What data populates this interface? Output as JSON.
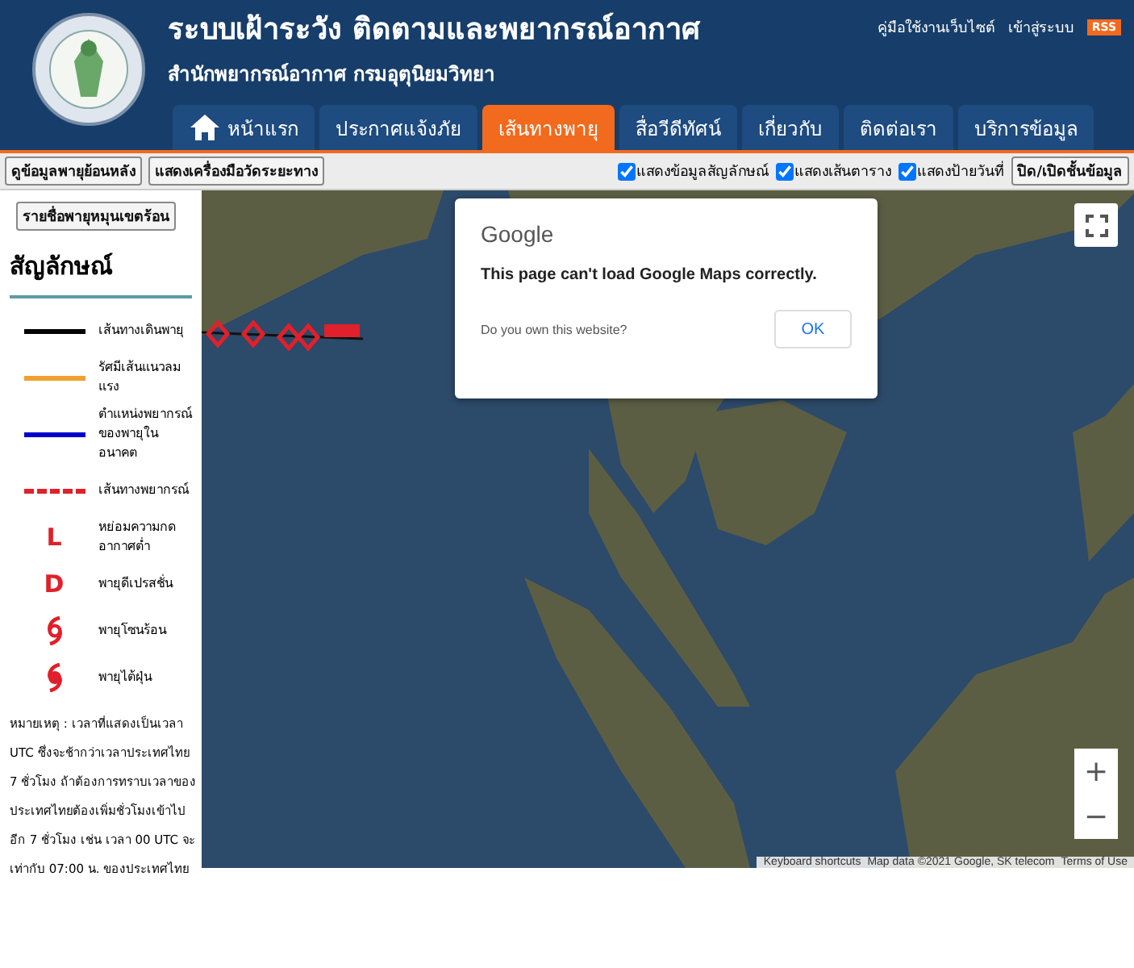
{
  "header": {
    "title": "ระบบเฝ้าระวัง ติดตามและพยากรณ์อากาศ",
    "subtitle": "สำนักพยากรณ์อากาศ กรมอุตุนิยมวิทยา",
    "links": [
      "คู่มือใช้งานเว็บไซต์",
      "เข้าสู่ระบบ"
    ],
    "rss": "RSS"
  },
  "nav": [
    {
      "label": "หน้าแรก",
      "home": true,
      "selected": false
    },
    {
      "label": "ประกาศแจ้งภัย",
      "home": false,
      "selected": false
    },
    {
      "label": "เส้นทางพายุ",
      "home": false,
      "selected": true
    },
    {
      "label": "สื่อวีดีทัศน์",
      "home": false,
      "selected": false
    },
    {
      "label": "เกี่ยวกับ",
      "home": false,
      "selected": false
    },
    {
      "label": "ติดต่อเรา",
      "home": false,
      "selected": false
    },
    {
      "label": "บริการข้อมูล",
      "home": false,
      "selected": false
    }
  ],
  "toolbar": {
    "buttons": [
      "ดูข้อมูลพายุย้อนหลัง",
      "แสดงเครื่องมือวัดระยะทาง"
    ],
    "checkboxes": [
      {
        "label": "แสดงข้อมูลสัญลักษณ์",
        "checked": true
      },
      {
        "label": "แสดงเส้นตาราง",
        "checked": true
      },
      {
        "label": "แสดงป้ายวันที่",
        "checked": true
      }
    ],
    "toggle": "ปิด/เปิดชั้นข้อมูล"
  },
  "sidebar": {
    "button": "รายชื่อพายุหมุนเขตร้อน",
    "heading": "สัญลักษณ์",
    "legend": [
      {
        "kind": "line",
        "color": "#000000",
        "label": "เส้นทางเดินพายุ"
      },
      {
        "kind": "line",
        "color": "#f0a030",
        "label": "รัศมีเส้นแนวลมแรง"
      },
      {
        "kind": "line",
        "color": "#0000cc",
        "label": "ตำแหน่งพยากรณ์ของพายุในอนาคต"
      },
      {
        "kind": "dashed",
        "color": "#e0202a",
        "label": "เส้นทางพยากรณ์"
      },
      {
        "kind": "letter",
        "symbol": "L",
        "label": "หย่อมความกดอากาศต่ำ"
      },
      {
        "kind": "letter",
        "symbol": "D",
        "label": "พายุดีเปรสชั่น"
      },
      {
        "kind": "storm",
        "label": "พายุโซนร้อน"
      },
      {
        "kind": "typhoon",
        "label": "พายุไต้ฝุ่น"
      }
    ],
    "note": "หมายเหตุ : เวลาที่แสดงเป็นเวลา UTC ซึ่งจะช้ากว่าเวลาประเทศไทย 7 ชั่วโมง ถ้าต้องการทราบเวลาของประเทศไทยต้องเพิ่มชั่วโมงเข้าไปอีก 7 ชั่วโมง เช่น เวลา 00 UTC จะเท่ากับ 07:00 น. ของประเทศไทย"
  },
  "map": {
    "kind": "picture",
    "dialog": {
      "brand": "Google",
      "message": "This page can't load Google Maps correctly.",
      "question": "Do you own this website?",
      "button": "OK"
    },
    "zoom": [
      "+",
      "−"
    ],
    "attribution": [
      "Keyboard shortcuts",
      "Map data ©2021 Google, SK telecom",
      "Terms of Use"
    ]
  }
}
